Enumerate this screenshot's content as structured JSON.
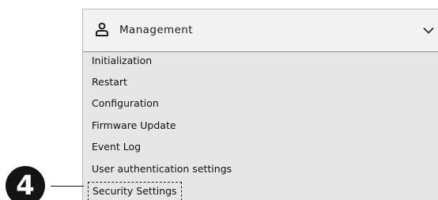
{
  "header": {
    "icon": "user-icon",
    "title": "Management",
    "chevron_icon": "chevron-down-icon"
  },
  "menu": {
    "items": [
      {
        "label": "Initialization"
      },
      {
        "label": "Restart"
      },
      {
        "label": "Configuration"
      },
      {
        "label": "Firmware Update"
      },
      {
        "label": "Event Log"
      },
      {
        "label": "User authentication settings"
      },
      {
        "label": "Security Settings",
        "selected": true
      }
    ]
  },
  "callout": {
    "number": "4"
  },
  "colors": {
    "panel_background": "#e6e6e6",
    "header_background": "#f2f2f2",
    "callout_badge": "#141414"
  }
}
